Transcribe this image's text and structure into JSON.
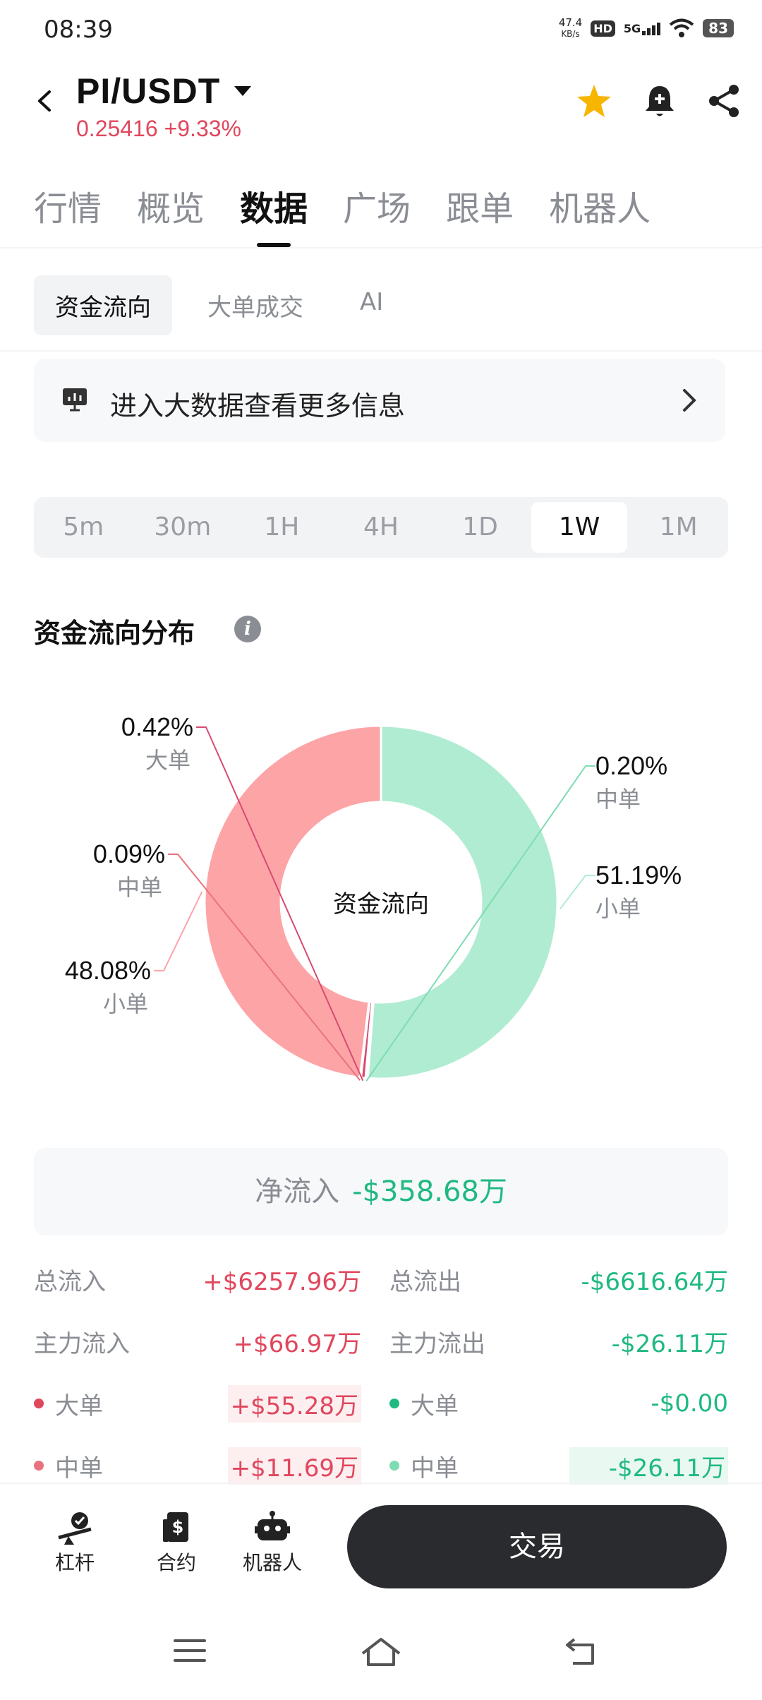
{
  "status": {
    "time": "08:39",
    "net_speed": "47.4",
    "net_unit": "KB/s",
    "hd": "HD",
    "signal": "5G",
    "battery": "83"
  },
  "header": {
    "pair": "PI/USDT",
    "price": "0.25416",
    "change": "+9.33%"
  },
  "tabs": [
    {
      "label": "行情"
    },
    {
      "label": "概览"
    },
    {
      "label": "数据"
    },
    {
      "label": "广场"
    },
    {
      "label": "跟单"
    },
    {
      "label": "机器人"
    }
  ],
  "active_tab": "数据",
  "subtabs": [
    {
      "label": "资金流向"
    },
    {
      "label": "大单成交"
    },
    {
      "label": "AI"
    }
  ],
  "banner": {
    "text": "进入大数据查看更多信息"
  },
  "periods": [
    {
      "label": "5m"
    },
    {
      "label": "30m"
    },
    {
      "label": "1H"
    },
    {
      "label": "4H"
    },
    {
      "label": "1D"
    },
    {
      "label": "1W"
    },
    {
      "label": "1M"
    }
  ],
  "active_period": "1W",
  "section_title": "资金流向分布",
  "chart_data": {
    "type": "pie",
    "title": "资金流向分布",
    "center_label": "资金流向",
    "slices": [
      {
        "label": "小单",
        "direction": "inflow",
        "value": 51.19,
        "text": "51.19%",
        "color": "#b0ecd2"
      },
      {
        "label": "中单",
        "direction": "inflow",
        "value": 0.2,
        "text": "0.20%",
        "color": "#7fdcb3"
      },
      {
        "label": "大单",
        "direction": "outflow",
        "value": 0.42,
        "text": "0.42%",
        "color": "#d94a70"
      },
      {
        "label": "中单",
        "direction": "outflow",
        "value": 0.09,
        "text": "0.09%",
        "color": "#e8737f"
      },
      {
        "label": "小单",
        "direction": "outflow",
        "value": 48.08,
        "text": "48.08%",
        "color": "#fda4a7"
      }
    ]
  },
  "net_flow": {
    "label": "净流入",
    "value": "-$358.68万"
  },
  "stats": {
    "rows": [
      {
        "left_label": "总流入",
        "left_value": "+$6257.96万",
        "right_label": "总流出",
        "right_value": "-$6616.64万",
        "dots": false
      },
      {
        "left_label": "主力流入",
        "left_value": "+$66.97万",
        "right_label": "主力流出",
        "right_value": "-$26.11万",
        "dots": false
      },
      {
        "left_label": "大单",
        "left_value": "+$55.28万",
        "right_label": "大单",
        "right_value": "-$0.00",
        "dots": true,
        "left_dot": "#e0475d",
        "right_dot": "#1fb981"
      },
      {
        "left_label": "中单",
        "left_value": "+$11.69万",
        "right_label": "中单",
        "right_value": "-$26.11万",
        "dots": true,
        "left_dot": "#e8737f",
        "right_dot": "#7fdcb3"
      }
    ]
  },
  "bottom_nav": [
    {
      "label": "杠杆",
      "icon": "leverage-icon"
    },
    {
      "label": "合约",
      "icon": "contract-icon"
    },
    {
      "label": "机器人",
      "icon": "robot-icon"
    }
  ],
  "trade_button": "交易",
  "colors": {
    "up": "#e0475d",
    "down": "#1fb981",
    "accent": "#f7b500"
  }
}
